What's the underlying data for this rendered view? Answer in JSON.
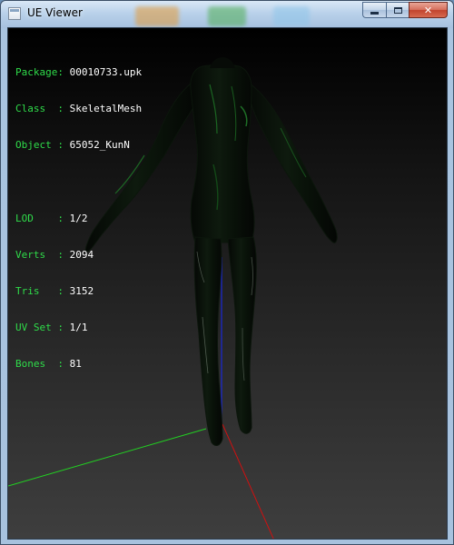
{
  "window": {
    "title": "UE Viewer",
    "controls": {
      "minimize": "minimize",
      "maximize": "maximize",
      "close": "✕"
    }
  },
  "info": {
    "group1": [
      {
        "key": "Package: ",
        "value": "00010733.upk"
      },
      {
        "key": "Class  : ",
        "value": "SkeletalMesh"
      },
      {
        "key": "Object : ",
        "value": "65052_KunN"
      }
    ],
    "group2": [
      {
        "key": "LOD    : ",
        "value": "1/2"
      },
      {
        "key": "Verts  : ",
        "value": "2094"
      },
      {
        "key": "Tris   : ",
        "value": "3152"
      },
      {
        "key": "UV Set : ",
        "value": "1/1"
      },
      {
        "key": "Bones  : ",
        "value": "81"
      }
    ]
  },
  "colors": {
    "info_key": "#2fdc4a",
    "info_value": "#ffffff",
    "axis_x": "#d01010",
    "axis_y": "#22d022",
    "axis_z": "#1a28d8",
    "viewport_bg_top": "#000000",
    "viewport_bg_bottom": "#3e3e3e",
    "mesh_fill": "#0b120b",
    "mesh_highlight": "#1f7a28"
  },
  "icons": [
    "app-window-icon",
    "minimize-icon",
    "maximize-icon",
    "close-icon"
  ]
}
